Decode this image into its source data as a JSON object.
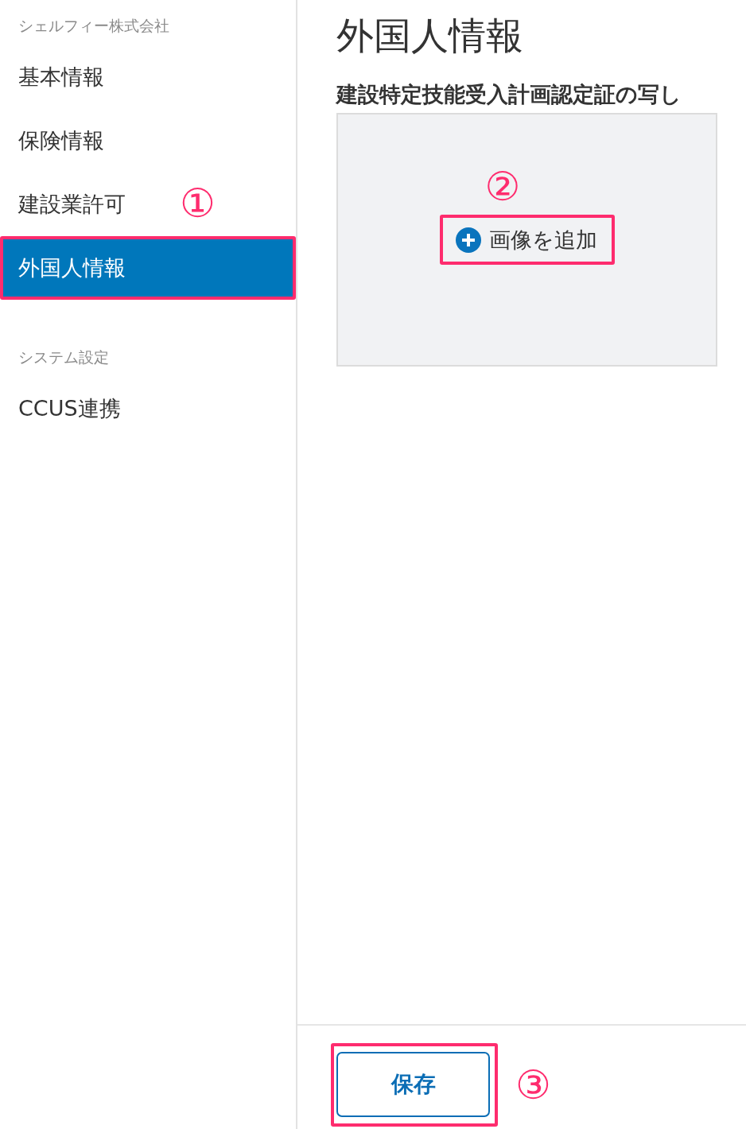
{
  "sidebar": {
    "groups": [
      {
        "label": "シェルフィー株式会社",
        "items": [
          {
            "label": "基本情報",
            "selected": false
          },
          {
            "label": "保険情報",
            "selected": false
          },
          {
            "label": "建設業許可",
            "selected": false
          },
          {
            "label": "外国人情報",
            "selected": true,
            "annotation": "①"
          }
        ]
      },
      {
        "label": "システム設定",
        "items": [
          {
            "label": "CCUS連携",
            "selected": false
          }
        ]
      }
    ]
  },
  "main": {
    "title": "外国人情報",
    "sections": [
      {
        "label": "建設特定技能受入計画認定証の写し",
        "upload": {
          "button": "画像を追加",
          "annotation": "②"
        }
      }
    ]
  },
  "footer": {
    "buttons": [
      {
        "label": "保存",
        "annotation": "③"
      }
    ]
  }
}
